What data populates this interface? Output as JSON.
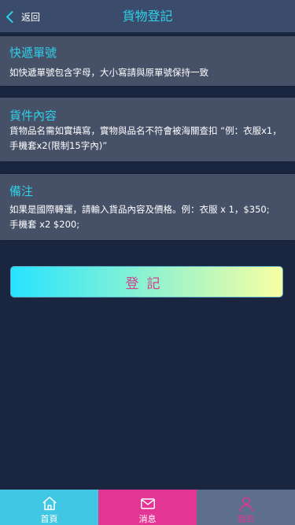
{
  "header": {
    "back_label": "返回",
    "title": "貨物登記"
  },
  "sections": [
    {
      "title": "快遞單號",
      "text": "如快遞單號包含字母，大小寫請與原單號保持一致"
    },
    {
      "title": "貨件內容",
      "text_lines": [
        "貨物品名需如實填寫，實物與品名不符會被海關查扣 “例：衣服x1，",
        "手機套x2(限制15字內)”"
      ]
    },
    {
      "title": "備注",
      "text_lines": [
        "如果是國際轉運，請輸入貨品內容及價格。例：衣服 x 1，$350;",
        "手機套 x2 $200;"
      ]
    }
  ],
  "submit_label": "登記",
  "tabbar": {
    "items": [
      {
        "label": "首頁",
        "icon": "home-icon"
      },
      {
        "label": "消息",
        "icon": "mail-icon"
      },
      {
        "label": "我的",
        "icon": "user-icon"
      }
    ]
  },
  "colors": {
    "accent": "#2fd0e8",
    "tab_home": "#3fc7e3",
    "tab_messages": "#e33694",
    "tab_me": "#5e6f8e",
    "submit_text": "#d0408b"
  }
}
